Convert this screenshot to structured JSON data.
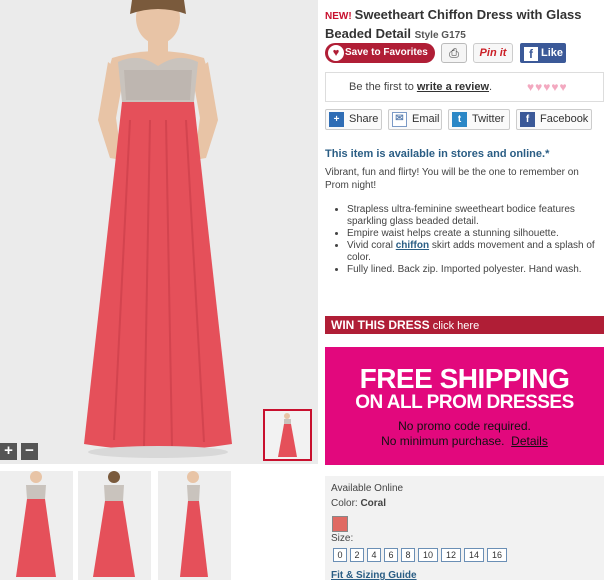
{
  "product": {
    "new_badge": "NEW!",
    "title": "Sweetheart Chiffon Dress with Glass Beaded Detail",
    "style_label": "Style G175"
  },
  "actions": {
    "favorites_label": "Save to Favorites",
    "print_icon": "printer-icon",
    "pinit_label": "Pin it",
    "like_label": "Like"
  },
  "review": {
    "prefix": "Be the first to ",
    "link": "write a review",
    "suffix": ".",
    "hearts": "♥♥♥♥♥"
  },
  "share": {
    "share_label": "Share",
    "email_label": "Email",
    "twitter_label": "Twitter",
    "facebook_label": "Facebook"
  },
  "availability": "This item is available in stores and online.*",
  "description": "Vibrant, fun and flirty! You will be the one to remember on Prom night!",
  "features": {
    "f1": "Strapless ultra-feminine sweetheart bodice features sparkling glass beaded detail.",
    "f2": "Empire waist helps create a stunning silhouette.",
    "f3_pre": "Vivid coral ",
    "f3_link": "chiffon",
    "f3_post": " skirt adds movement and a splash of color.",
    "f4": "Fully lined. Back zip. Imported polyester. Hand wash."
  },
  "win": {
    "bold": "WIN THIS DRESS",
    "link": " click here"
  },
  "promo": {
    "line1": "FREE SHIPPING",
    "line2": "ON ALL PROM DRESSES",
    "line3": "No promo code required.",
    "line4": "No minimum purchase.",
    "details": "Details"
  },
  "options": {
    "available": "Available Online",
    "color_label": "Color: ",
    "color_value": "Coral",
    "swatch_color": "#e06a63",
    "size_label": "Size:",
    "sizes": [
      "0",
      "2",
      "4",
      "6",
      "8",
      "10",
      "12",
      "14",
      "16"
    ],
    "fit_guide": "Fit & Sizing Guide"
  },
  "gallery": {
    "zoom_in": "+",
    "zoom_out": "−"
  },
  "colors": {
    "dress": "#e5505a",
    "accent": "#b01e36",
    "promo": "#e2087d",
    "link": "#2a5d84"
  }
}
